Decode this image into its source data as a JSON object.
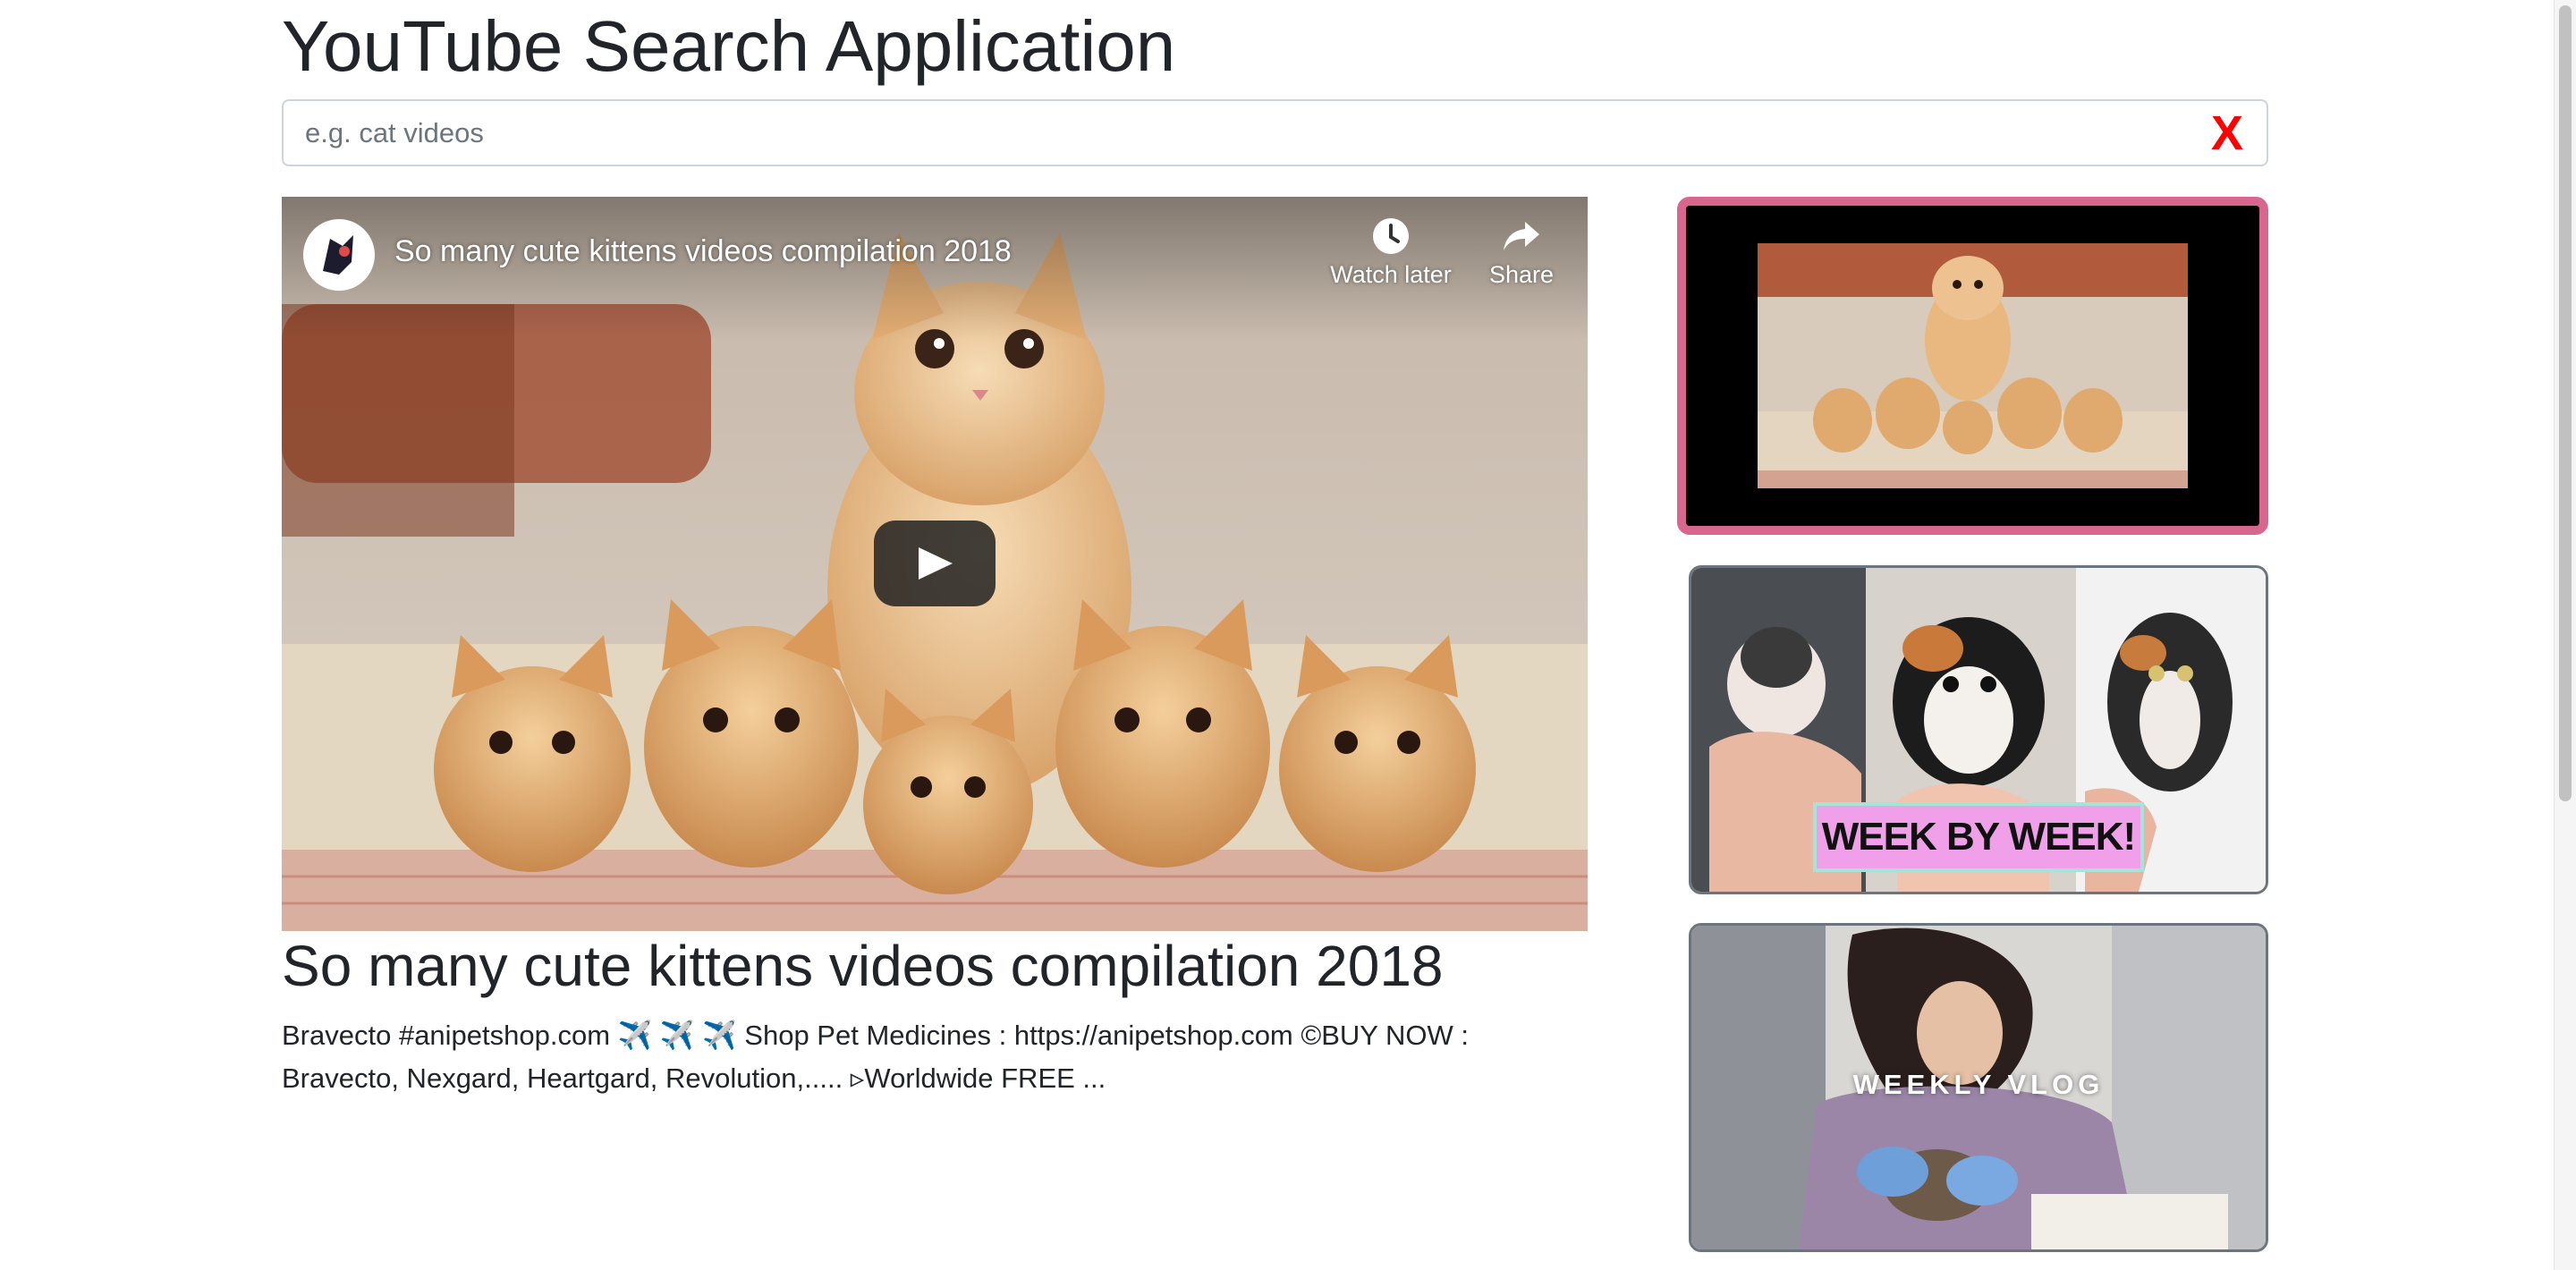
{
  "app": {
    "title": "YouTube Search Application"
  },
  "search": {
    "placeholder": "e.g. cat videos",
    "value": "",
    "clear_label": "X",
    "clear_color": "#ff0000"
  },
  "player": {
    "title": "So many cute kittens videos compilation 2018",
    "watch_later_label": "Watch later",
    "share_label": "Share",
    "icons": [
      "clock-icon",
      "share-arrow-icon",
      "play-icon"
    ]
  },
  "selected_video": {
    "title": "So many cute kittens videos compilation 2018",
    "description": "Bravecto #anipetshop.com ✈️ ✈️ ✈️ Shop Pet Medicines : https://anipetshop.com ©BUY NOW : Bravecto, Nexgard, Heartgard, Revolution,..... ▹Worldwide FREE ..."
  },
  "thumbnails": [
    {
      "active": true,
      "border_color": "#d9668e",
      "overlay_text": ""
    },
    {
      "active": false,
      "border_color": "#6c757d",
      "overlay_text": "WEEK BY WEEK!"
    },
    {
      "active": false,
      "border_color": "#6c757d",
      "overlay_text": "WEEKLY VLOG"
    }
  ]
}
